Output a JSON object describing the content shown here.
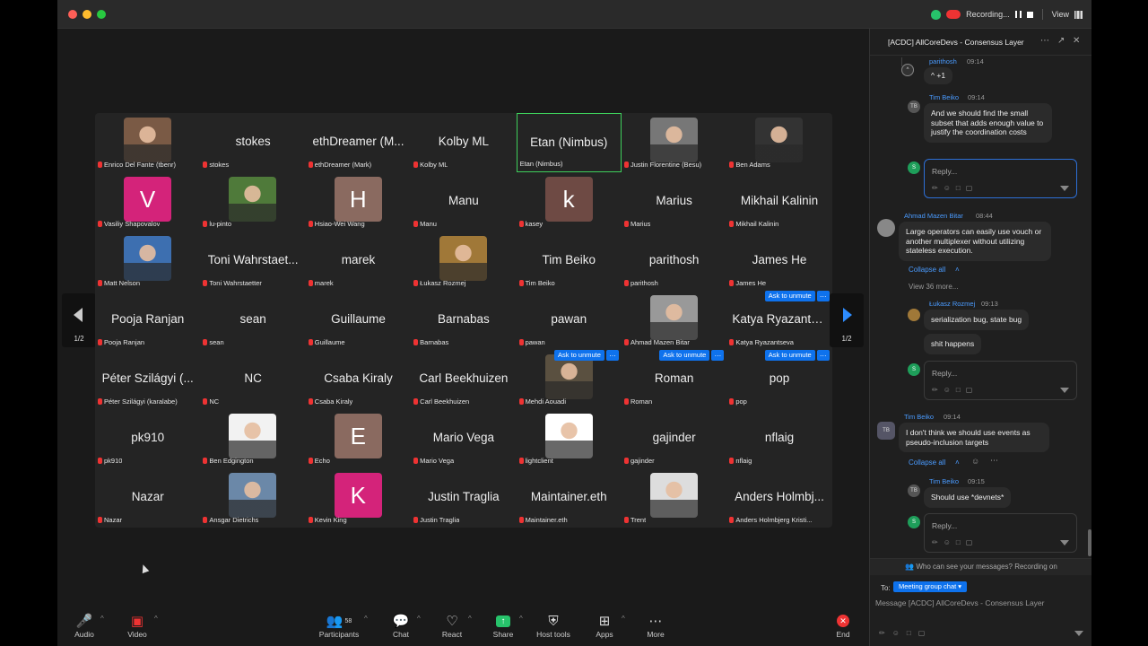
{
  "window": {
    "recording_label": "Recording...",
    "view_label": "View"
  },
  "nav": {
    "page": "1/2"
  },
  "grid": [
    {
      "big": "",
      "name": "Enrico Del Fante (tbenr)",
      "avatar": "photo",
      "color": "#7a5a45"
    },
    {
      "big": "stokes",
      "name": "stokes"
    },
    {
      "big": "ethDreamer (M...",
      "name": "ethDreamer (Mark)"
    },
    {
      "big": "Kolby ML",
      "name": "Kolby ML"
    },
    {
      "big": "Etan (Nimbus)",
      "name": "Etan (Nimbus)",
      "active": true,
      "nomic": true
    },
    {
      "big": "",
      "name": "Justin Florentine (Besu)",
      "avatar": "photo",
      "color": "#777"
    },
    {
      "big": "",
      "name": "Ben Adams",
      "avatar": "photo",
      "color": "#333"
    },
    {
      "big": "",
      "name": "Vasiliy Shapovalov",
      "avatar": "letter",
      "letter": "V",
      "color": "#d4237a"
    },
    {
      "big": "",
      "name": "lu-pinto",
      "avatar": "photo",
      "color": "#4f7a3a"
    },
    {
      "big": "",
      "name": "Hsiao-Wei Wang",
      "avatar": "letter",
      "letter": "H",
      "color": "#8a6a60"
    },
    {
      "big": "Manu",
      "name": "Manu"
    },
    {
      "big": "",
      "name": "kasey",
      "avatar": "letter",
      "letter": "k",
      "color": "#6e4a44"
    },
    {
      "big": "Marius",
      "name": "Marius"
    },
    {
      "big": "Mikhail Kalinin",
      "name": "Mikhail Kalinin"
    },
    {
      "big": "",
      "name": "Matt Nelson",
      "avatar": "photo",
      "color": "#3d6fb0"
    },
    {
      "big": "Toni Wahrstaet...",
      "name": "Toni Wahrstaetter"
    },
    {
      "big": "marek",
      "name": "marek"
    },
    {
      "big": "",
      "name": "Łukasz Rozmej",
      "avatar": "photo",
      "color": "#a07838"
    },
    {
      "big": "Tim Beiko",
      "name": "Tim Beiko"
    },
    {
      "big": "parithosh",
      "name": "parithosh"
    },
    {
      "big": "James He",
      "name": "James He"
    },
    {
      "big": "Pooja Ranjan",
      "name": "Pooja Ranjan"
    },
    {
      "big": "sean",
      "name": "sean"
    },
    {
      "big": "Guillaume",
      "name": "Guillaume"
    },
    {
      "big": "Barnabas",
      "name": "Barnabas"
    },
    {
      "big": "pawan",
      "name": "pawan"
    },
    {
      "big": "",
      "name": "Ahmad Mazen Bitar",
      "avatar": "photo",
      "color": "#999"
    },
    {
      "big": "Katya Ryazants...",
      "name": "Katya Ryazantseva",
      "ask": true
    },
    {
      "big": "Péter Szilágyi (...",
      "name": "Péter Szilágyi (karalabe)"
    },
    {
      "big": "NC",
      "name": "NC"
    },
    {
      "big": "Csaba Kiraly",
      "name": "Csaba Kiraly"
    },
    {
      "big": "Carl Beekhuizen",
      "name": "Carl Beekhuizen"
    },
    {
      "big": "",
      "name": "Mehdi Aouadi",
      "avatar": "photo",
      "color": "#5a5040",
      "ask": true
    },
    {
      "big": "Roman",
      "name": "Roman",
      "ask": true
    },
    {
      "big": "pop",
      "name": "pop",
      "ask": true
    },
    {
      "big": "pk910",
      "name": "pk910"
    },
    {
      "big": "",
      "name": "Ben Edgington",
      "avatar": "photo",
      "color": "#f2f2f2"
    },
    {
      "big": "",
      "name": "Echo",
      "avatar": "letter",
      "letter": "E",
      "color": "#8a6a60"
    },
    {
      "big": "Mario Vega",
      "name": "Mario Vega"
    },
    {
      "big": "",
      "name": "lightclient",
      "avatar": "photo",
      "color": "#fff"
    },
    {
      "big": "gajinder",
      "name": "gajinder"
    },
    {
      "big": "nflaig",
      "name": "nflaig"
    },
    {
      "big": "Nazar",
      "name": "Nazar"
    },
    {
      "big": "",
      "name": "Ansgar Dietrichs",
      "avatar": "photo",
      "color": "#6b88a8"
    },
    {
      "big": "",
      "name": "Kevin King",
      "avatar": "letter",
      "letter": "K",
      "color": "#d4237a"
    },
    {
      "big": "Justin Traglia",
      "name": "Justin Traglia"
    },
    {
      "big": "Maintainer.eth",
      "name": "Maintainer.eth"
    },
    {
      "big": "",
      "name": "Trent",
      "avatar": "photo",
      "color": "#ddd"
    },
    {
      "big": "Anders Holmbj...",
      "name": "Anders Holmbjerg Kristi..."
    }
  ],
  "ask_label": "Ask to unmute",
  "toolbar": {
    "audio": "Audio",
    "video": "Video",
    "participants": "Participants",
    "participants_count": "58",
    "chat": "Chat",
    "react": "React",
    "share": "Share",
    "host_tools": "Host tools",
    "apps": "Apps",
    "more": "More",
    "end": "End"
  },
  "chat": {
    "title": "[ACDC] AllCoreDevs - Consensus Layer",
    "m1_user": "parithosh",
    "m1_time": "09:14",
    "m1_text": "^ +1",
    "m2_user": "Tim Beiko",
    "m2_time": "09:14",
    "m2_text": "And we should find the small subset that adds enough value to justify the coordination costs",
    "reply_placeholder": "Reply...",
    "m3_user": "Ahmad Mazen Bitar",
    "m3_time": "08:44",
    "m3_text": "Large operators can easily use vouch or another multiplexer without utilizing stateless execution.",
    "collapse": "Collapse all",
    "view_more": "View 36 more...",
    "m4_user": "Łukasz Rozmej",
    "m4_time": "09:13",
    "m4_text1": "serialization bug, state bug",
    "m4_text2": "shit happens",
    "m5_user": "Tim Beiko",
    "m5_time": "09:14",
    "m5_text": "I don't think we should use events as pseudo-inclusion targets",
    "m6_user": "Tim Beiko",
    "m6_time": "09:15",
    "m6_text": "Should use *devnets*",
    "privacy": "Who can see your messages? Recording on",
    "to_label": "To:",
    "to_value": "Meeting group chat",
    "composer_placeholder": "Message [ACDC] AllCoreDevs - Consensus Layer",
    "initials_tb": "TB",
    "initials_s": "S"
  }
}
